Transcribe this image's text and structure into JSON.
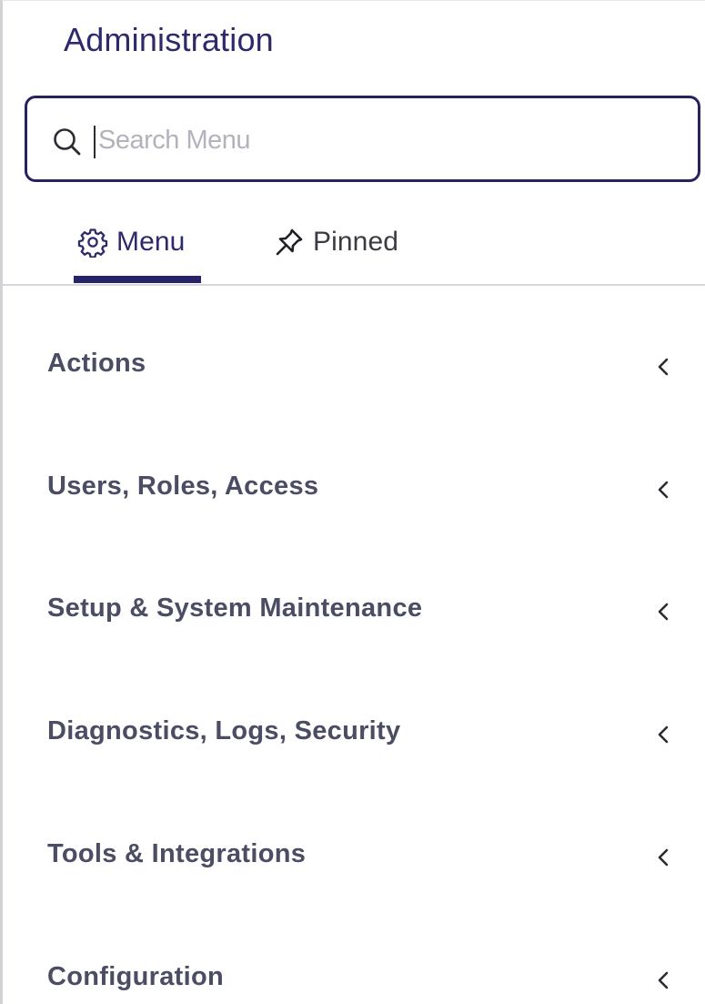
{
  "header": {
    "title": "Administration"
  },
  "search": {
    "placeholder": "Search Menu",
    "value": "",
    "icon": "search-icon"
  },
  "tabs": [
    {
      "label": "Menu",
      "icon": "gear-icon",
      "active": true
    },
    {
      "label": "Pinned",
      "icon": "pin-icon",
      "active": false
    }
  ],
  "menu": {
    "items": [
      {
        "label": "Actions",
        "icon": "chevron-left-icon"
      },
      {
        "label": "Users, Roles, Access",
        "icon": "chevron-left-icon"
      },
      {
        "label": "Setup & System Maintenance",
        "icon": "chevron-left-icon"
      },
      {
        "label": "Diagnostics, Logs, Security",
        "icon": "chevron-left-icon"
      },
      {
        "label": "Tools & Integrations",
        "icon": "chevron-left-icon"
      },
      {
        "label": "Configuration",
        "icon": "chevron-left-icon"
      }
    ]
  },
  "colors": {
    "accent": "#27236a",
    "title": "#2d2a6b",
    "menu_text": "#4a4d63",
    "placeholder": "#b3b3bd",
    "divider": "#d6d6dc"
  }
}
